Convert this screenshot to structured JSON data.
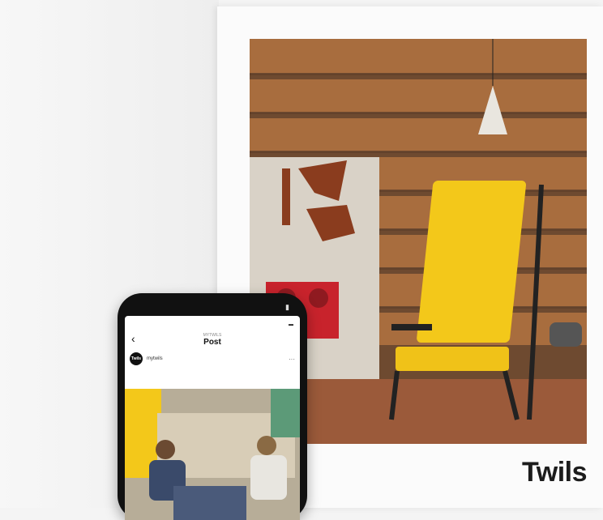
{
  "catalog": {
    "brand": "Twils"
  },
  "phone": {
    "carrier_status": "",
    "instagram": {
      "status_left": "",
      "status_time": "",
      "account": "MYTWILS",
      "title": "Post",
      "username": "mytwils",
      "avatar_text": "Twils",
      "more": "···",
      "back": "‹"
    }
  },
  "colors": {
    "chair_yellow": "#f3c81a",
    "radio_red": "#c8232c",
    "shelf_wood": "#a0643a"
  }
}
